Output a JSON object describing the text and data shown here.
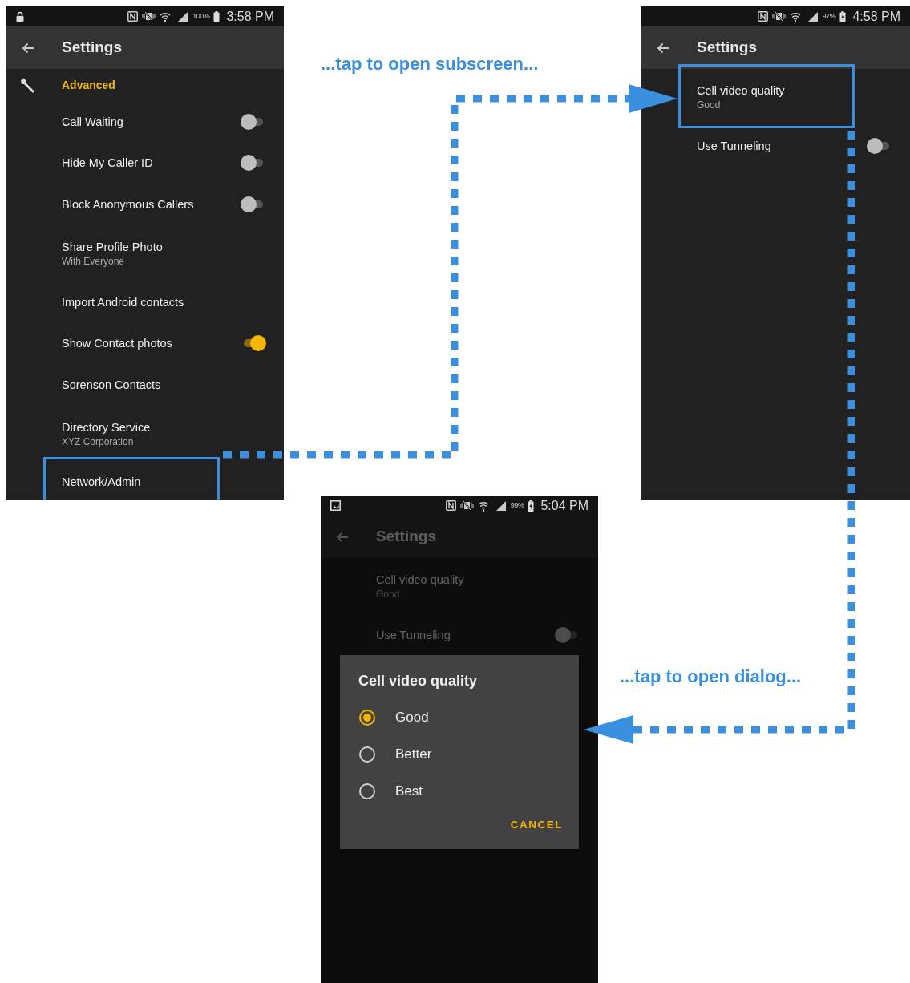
{
  "screens": [
    {
      "status_bar": {
        "lock": true,
        "battery_percent": "100%",
        "charging": false,
        "time": "3:58 PM"
      },
      "title": "Settings",
      "dimmed": false,
      "items": [
        {
          "kind": "header",
          "title": "Advanced"
        },
        {
          "kind": "switch",
          "title": "Call Waiting",
          "on": false
        },
        {
          "kind": "switch",
          "title": "Hide My Caller ID",
          "on": false
        },
        {
          "kind": "switch",
          "title": "Block Anonymous Callers",
          "on": false
        },
        {
          "kind": "text",
          "title": "Share Profile Photo",
          "summary": "With Everyone"
        },
        {
          "kind": "text",
          "title": "Import Android contacts"
        },
        {
          "kind": "switch",
          "title": "Show Contact photos",
          "on": true
        },
        {
          "kind": "text",
          "title": "Sorenson Contacts"
        },
        {
          "kind": "text",
          "title": "Directory Service",
          "summary": "XYZ Corporation"
        },
        {
          "kind": "text",
          "title": "Network/Admin",
          "highlighted": true
        }
      ]
    },
    {
      "status_bar": {
        "battery_percent": "97%",
        "charging": true,
        "time": "4:58 PM"
      },
      "title": "Settings",
      "dimmed": false,
      "items": [
        {
          "kind": "text",
          "title": "Cell video quality",
          "summary": "Good",
          "highlighted": true
        },
        {
          "kind": "switch",
          "title": "Use Tunneling",
          "on": false
        }
      ]
    },
    {
      "status_bar": {
        "screenshot_saved": true,
        "battery_percent": "99%",
        "charging": true,
        "time": "5:04 PM"
      },
      "title": "Settings",
      "dimmed": true,
      "items": [
        {
          "kind": "text",
          "title": "Cell video quality",
          "summary": "Good"
        },
        {
          "kind": "switch",
          "title": "Use Tunneling",
          "on": false
        }
      ],
      "dialog": {
        "title": "Cell video quality",
        "options": [
          {
            "label": "Good",
            "selected": true
          },
          {
            "label": "Better",
            "selected": false
          },
          {
            "label": "Best",
            "selected": false
          }
        ],
        "button": "CANCEL"
      }
    }
  ],
  "callouts": [
    "...tap to open subscreen...",
    "...tap to open dialog..."
  ]
}
